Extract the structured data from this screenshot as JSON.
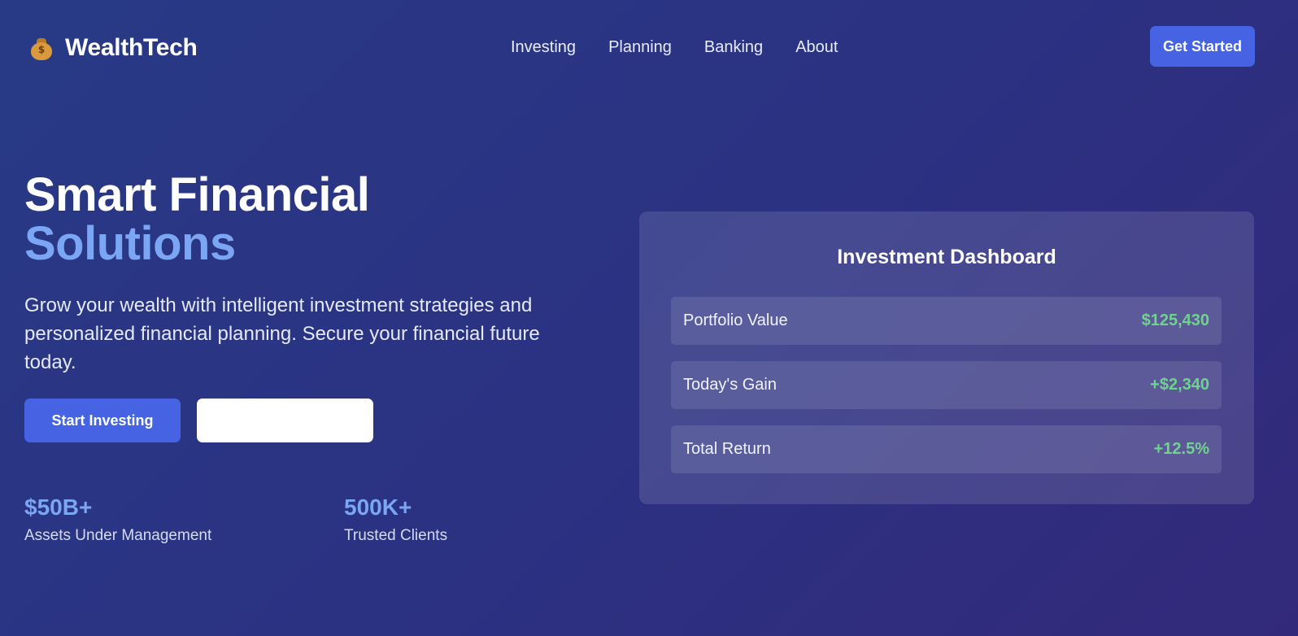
{
  "brand": {
    "name": "WealthTech",
    "icon": "money-bag-icon"
  },
  "nav": {
    "links": [
      "Investing",
      "Planning",
      "Banking",
      "About"
    ],
    "cta_label": "Get Started"
  },
  "hero": {
    "title_line1": "Smart Financial",
    "title_line2": "Solutions",
    "subtitle": "Grow your wealth with intelligent investment strategies and personalized financial planning. Secure your financial future today.",
    "primary_button": "Start Investing",
    "secondary_button": ""
  },
  "stats": [
    {
      "value": "$50B+",
      "label": "Assets Under Management"
    },
    {
      "value": "500K+",
      "label": "Trusted Clients"
    }
  ],
  "dashboard": {
    "title": "Investment Dashboard",
    "metrics": [
      {
        "label": "Portfolio Value",
        "value": "$125,430"
      },
      {
        "label": "Today's Gain",
        "value": "+$2,340"
      },
      {
        "label": "Total Return",
        "value": "+12.5%"
      }
    ]
  },
  "colors": {
    "accent": "#4563e3",
    "highlight": "#7aa6f4",
    "positive": "#6fd38e",
    "background_start": "#283a86",
    "background_end": "#33297a"
  }
}
